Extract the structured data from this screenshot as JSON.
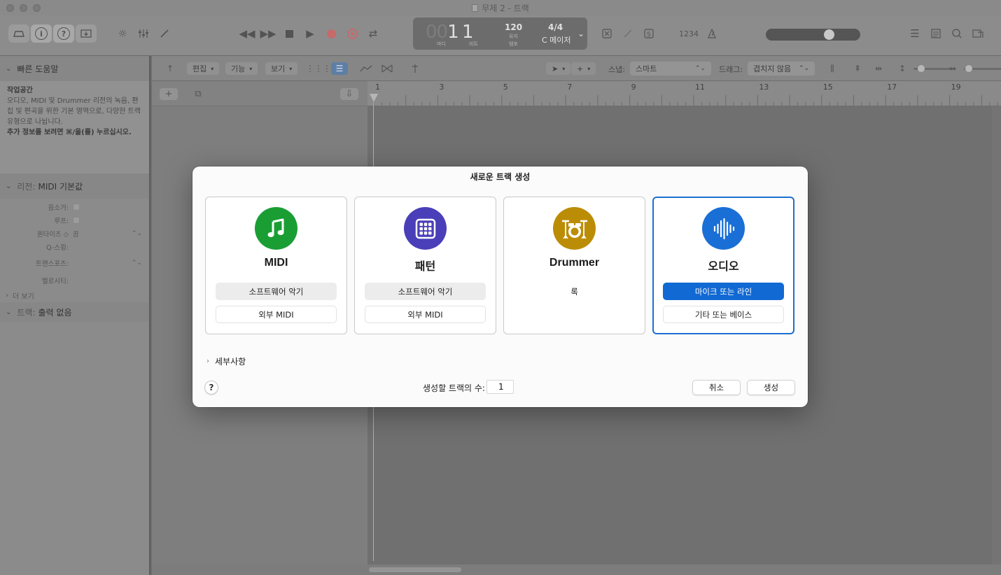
{
  "window": {
    "title": "무제 2 - 트랙"
  },
  "lcd": {
    "bar_ghost": "00",
    "bar": "1",
    "beat": "1",
    "bar_caption": "마디",
    "beat_caption": "비트",
    "tempo": "120",
    "tempo_caption1": "유지",
    "tempo_caption2": "템포",
    "time_signature": "4/4",
    "key": "C 메이저"
  },
  "toolbar": {
    "counter_text": "1234"
  },
  "left_panel": {
    "quick_help_header": "빠른 도움말",
    "help_title": "작업공간",
    "help_body": "오디오, MIDI 및 Drummer 리전의 녹음, 편집 및 편곡을 위한 기본 영역으로, 다양한 트랙 유형으로 나뉩니다.",
    "help_more": "추가 정보를 보려면 ⌘/을(를) 누르십시오.",
    "region_header_prefix": "리전:",
    "region_header_value": "MIDI 기본값",
    "rows": [
      {
        "label": "음소거:",
        "value": ""
      },
      {
        "label": "루프:",
        "value": ""
      },
      {
        "label": "퀀타이즈 ◇",
        "value": "끔"
      },
      {
        "label": "Q-스윙:",
        "value": ""
      },
      {
        "label": "트랜스포즈:",
        "value": ""
      },
      {
        "label": "벨로시티:",
        "value": ""
      }
    ],
    "more_label": "더 보기",
    "track_header_prefix": "트랙:",
    "track_header_value": "출력 없음"
  },
  "local_bar": {
    "edit_menu": "편집",
    "function_menu": "기능",
    "view_menu": "보기",
    "snap_label": "스냅:",
    "snap_value": "스마트",
    "drag_label": "드래그:",
    "drag_value": "겹치지 않음"
  },
  "ruler": {
    "markers": [
      "1",
      "3",
      "5",
      "7",
      "9",
      "11",
      "13",
      "15",
      "17",
      "19"
    ]
  },
  "dialog": {
    "title": "새로운 트랙 생성",
    "cards": [
      {
        "label": "MIDI",
        "icon": "music-note-icon",
        "color": "#1a9e34",
        "options": [
          "소프트웨어 악기",
          "외부 MIDI"
        ]
      },
      {
        "label": "패턴",
        "icon": "grid-pad-icon",
        "color": "#4a3fb8",
        "options": [
          "소프트웨어 악기",
          "외부 MIDI"
        ]
      },
      {
        "label": "Drummer",
        "icon": "drum-kit-icon",
        "color": "#bb8d06",
        "options": [
          "록"
        ]
      },
      {
        "label": "오디오",
        "icon": "waveform-icon",
        "color": "#1a6fd6",
        "options": [
          "마이크 또는 라인",
          "기타 또는 베이스"
        ]
      }
    ],
    "details_label": "세부사항",
    "help_label": "?",
    "count_label": "생성할 트랙의 수:",
    "count_value": "1",
    "cancel_label": "취소",
    "create_label": "생성",
    "accent_color": "#1169d3"
  }
}
